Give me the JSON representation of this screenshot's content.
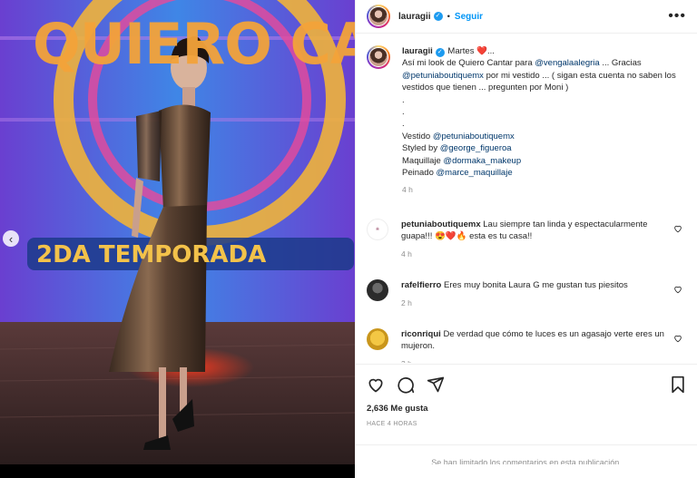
{
  "post": {
    "username": "lauragii",
    "follow_label": "Seguir",
    "dot": "•",
    "more_label": "•••"
  },
  "caption": {
    "username": "lauragii",
    "line1_text": " Martes ❤️...",
    "line2a": "Así mi look de Quiero Cantar para ",
    "line2_mention": "@vengalaalegria",
    "line2b": " ... Gracias",
    "line3_mention": "@petuniaboutiquemx",
    "line3b": " por mi vestido ... ( sigan esta cuenta no saben los vestidos que tienen ... pregunten por Moni )",
    "dots": [
      ".",
      ".",
      "."
    ],
    "credits": [
      {
        "prefix": "Vestido ",
        "mention": "@petuniaboutiquemx"
      },
      {
        "prefix": "Styled by ",
        "mention": "@george_figueroa"
      },
      {
        "prefix": "Maquillaje ",
        "mention": "@dormaka_makeup"
      },
      {
        "prefix": "Peinado ",
        "mention": "@marce_maquillaje"
      }
    ],
    "time": "4 h"
  },
  "comments": [
    {
      "user": "petuniaboutiquemx",
      "text": " Lau siempre tan linda y espectacularmente guapa!!! 😍❤️🔥 esta es tu casa!!",
      "time": "4 h"
    },
    {
      "user": "rafelfierro",
      "text": " Eres muy bonita Laura G me gustan tus piesitos",
      "time": "2 h"
    },
    {
      "user": "riconriqui",
      "text": " De verdad que cómo te luces es un agasajo verte eres un mujeron.",
      "time": "3 h"
    }
  ],
  "stats": {
    "likes": "2,636 Me gusta",
    "posted_ago": "HACE 4 HORAS"
  },
  "footer": {
    "limited_text": "Se han limitado los comentarios en esta publicación."
  },
  "media": {
    "sign_top": "QUIERO CANTAR",
    "sign_season": "2DA TEMPORADA",
    "prev_label": "‹"
  }
}
